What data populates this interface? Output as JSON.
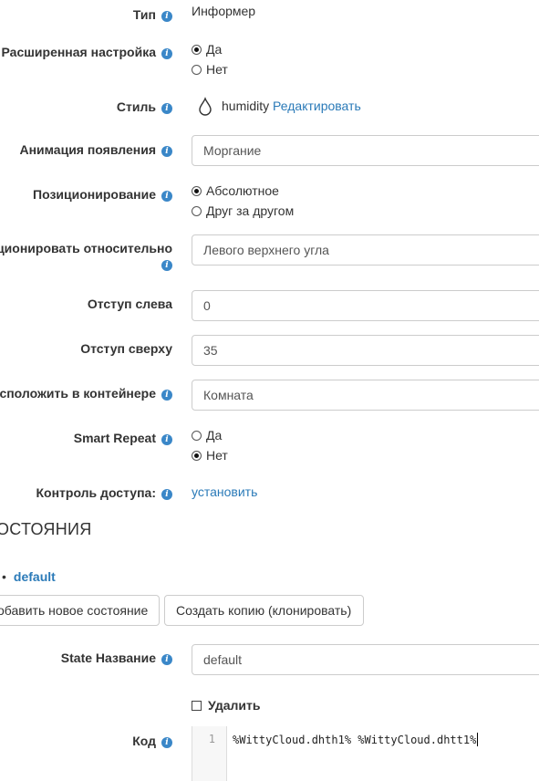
{
  "fields": {
    "type": {
      "label": "Тип",
      "value": "Информер"
    },
    "advanced": {
      "label": "Расширенная настройка",
      "options": [
        "Да",
        "Нет"
      ],
      "selected": 0
    },
    "style": {
      "label": "Стиль",
      "icon": "humidity-drop-icon",
      "value": "humidity",
      "edit_link": "Редактировать"
    },
    "animation": {
      "label": "Анимация появления",
      "value": "Моргание"
    },
    "positioning": {
      "label": "Позиционирование",
      "options": [
        "Абсолютное",
        "Друг за другом"
      ],
      "selected": 0
    },
    "position_relative": {
      "label": "ционировать относительно",
      "value": "Левого верхнего угла"
    },
    "offset_left": {
      "label": "Отступ слева",
      "value": "0"
    },
    "offset_top": {
      "label": "Отступ сверху",
      "value": "35"
    },
    "container": {
      "label": "сположить в контейнере",
      "value": "Комната"
    },
    "smart_repeat": {
      "label": "Smart Repeat",
      "options": [
        "Да",
        "Нет"
      ],
      "selected": 1
    },
    "access": {
      "label": "Контроль доступа:",
      "link": "установить"
    }
  },
  "states": {
    "section_title": "ОСТОЯНИЯ",
    "bullet": "•",
    "items": [
      "default"
    ],
    "add_button": "обавить новое состояние",
    "clone_button": "Создать копию (клонировать)",
    "name_label": "State Название",
    "name_value": "default",
    "delete_label": "Удалить",
    "code_label": "Код",
    "code_line_number": "1",
    "code_text": "%WittyCloud.dhth1% %WittyCloud.dhtt1%"
  },
  "colors": {
    "link": "#2a7ab8",
    "info_icon": "#3a87c8"
  }
}
